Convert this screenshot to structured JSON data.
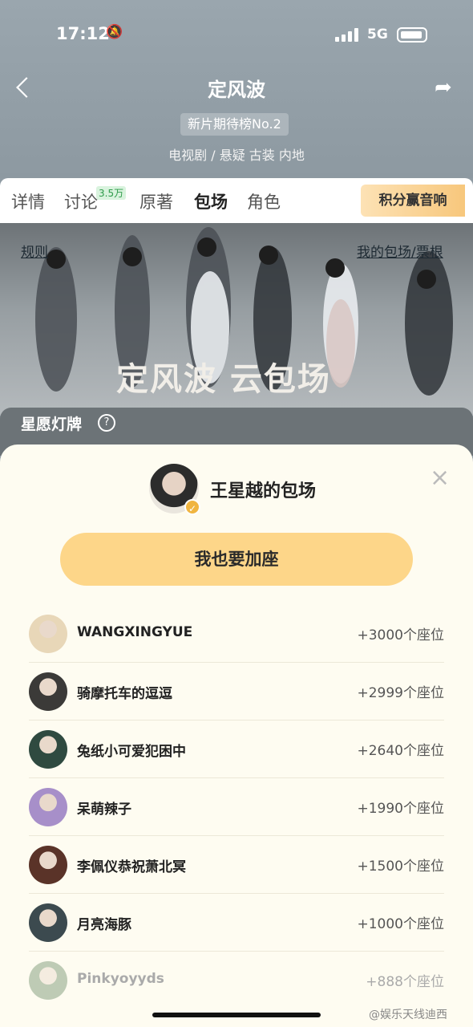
{
  "status_bar": {
    "time": "17:12",
    "network": "5G"
  },
  "header": {
    "title": "定风波",
    "rank_badge": "新片期待榜No.2",
    "meta": "电视剧 / 悬疑 古装 内地"
  },
  "tabs": [
    {
      "label": "详情"
    },
    {
      "label": "讨论",
      "badge": "3.5万"
    },
    {
      "label": "原著"
    },
    {
      "label": "包场",
      "active": true
    },
    {
      "label": "角色"
    }
  ],
  "promo_label": "积分赢音响",
  "banner": {
    "rules_link": "规则",
    "my_link": "我的包场/票根",
    "logo_text": "定风波 云包场"
  },
  "lamp_section": {
    "title": "星愿灯牌",
    "help": "?"
  },
  "sheet": {
    "host_title": "王星越的包场",
    "close_icon": "×",
    "join_button": "我也要加座",
    "rows": [
      {
        "name": "WANGXINGYUE",
        "seats": "+3000个座位",
        "avatar_color": "#e8d7b8"
      },
      {
        "name": "骑摩托车的逗逗",
        "seats": "+2999个座位",
        "avatar_color": "#3b3a38"
      },
      {
        "name": "兔纸小可爱犯困中",
        "seats": "+2640个座位",
        "avatar_color": "#2f4a40"
      },
      {
        "name": "呆萌辣子",
        "seats": "+1990个座位",
        "avatar_color": "#a78fc9"
      },
      {
        "name": "李佩仪恭祝萧北冥",
        "seats": "+1500个座位",
        "avatar_color": "#5a3328"
      },
      {
        "name": "月亮海豚",
        "seats": "+1000个座位",
        "avatar_color": "#3c4a4f"
      },
      {
        "name": "Pinkyoyyds",
        "seats": "+888个座位",
        "avatar_color": "#6f8f6b"
      }
    ]
  },
  "watermark": "@娱乐天线迪西"
}
